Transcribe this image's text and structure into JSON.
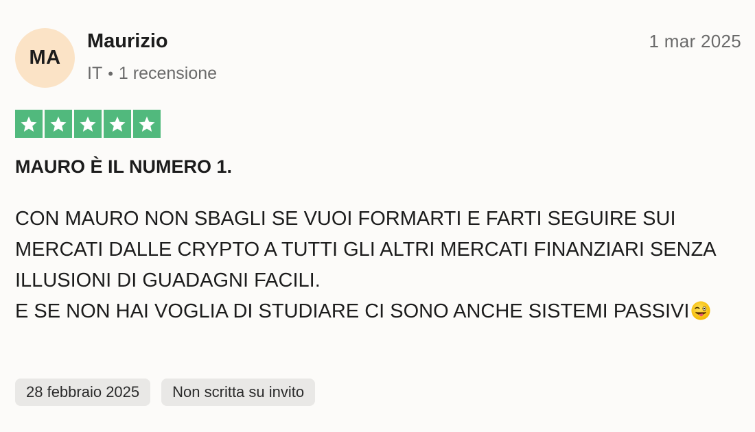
{
  "reviewer": {
    "initials": "MA",
    "name": "Maurizio",
    "country": "IT",
    "separator": "•",
    "review_count": "1 recensione"
  },
  "review": {
    "date_short": "1 mar 2025",
    "rating": 5,
    "rating_max": 5,
    "star_color": "#51b97d",
    "star_icon": "star-icon",
    "title": "MAURO È IL NUMERO 1.",
    "body_lines": [
      "CON MAURO NON SBAGLI SE VUOI FORMARTI E FARTI SEGUIRE SUI MERCATI DALLE CRYPTO A TUTTI GLI ALTRI MERCATI FINANZIARI SENZA ILLUSIONI DI GUADAGNI FACILI.",
      "E SE NON HAI VOGLIA DI STUDIARE CI SONO ANCHE SISTEMI PASSIVI"
    ],
    "body_emoji": "winking-face-with-tongue-emoji"
  },
  "chips": {
    "experience_date": "28 febbraio 2025",
    "invite_status": "Non scritta su invito"
  }
}
